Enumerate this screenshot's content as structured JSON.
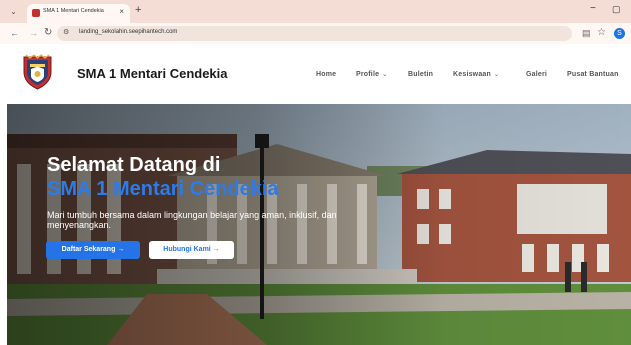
{
  "browser": {
    "tab_title": "SMA 1 Mentari Cendekia",
    "tab_close": "×",
    "new_tab": "+",
    "url": "landing_sekolahin.seepihantech.com",
    "profile_initial": "S",
    "window_min": "−",
    "window_max": "▢"
  },
  "header": {
    "site_name": "SMA 1 Mentari Cendekia",
    "nav": [
      {
        "label": "Home",
        "dropdown": false
      },
      {
        "label": "Profile",
        "dropdown": true
      },
      {
        "label": "Buletin",
        "dropdown": false
      },
      {
        "label": "Kesiswaan",
        "dropdown": true
      },
      {
        "label": "Galeri",
        "dropdown": false
      },
      {
        "label": "Pusat Bantuan",
        "dropdown": false
      }
    ]
  },
  "hero": {
    "title": "Selamat Datang di",
    "school": "SMA 1 Mentari Cendekia",
    "description": "Mari tumbuh bersama dalam lingkungan belajar yang aman, inklusif, dan menyenangkan.",
    "primary_button": "Daftar Sekarang →",
    "secondary_button": "Hubungi Kami →"
  },
  "colors": {
    "accent": "#2573e6",
    "tabbar": "#f3ddd4"
  }
}
